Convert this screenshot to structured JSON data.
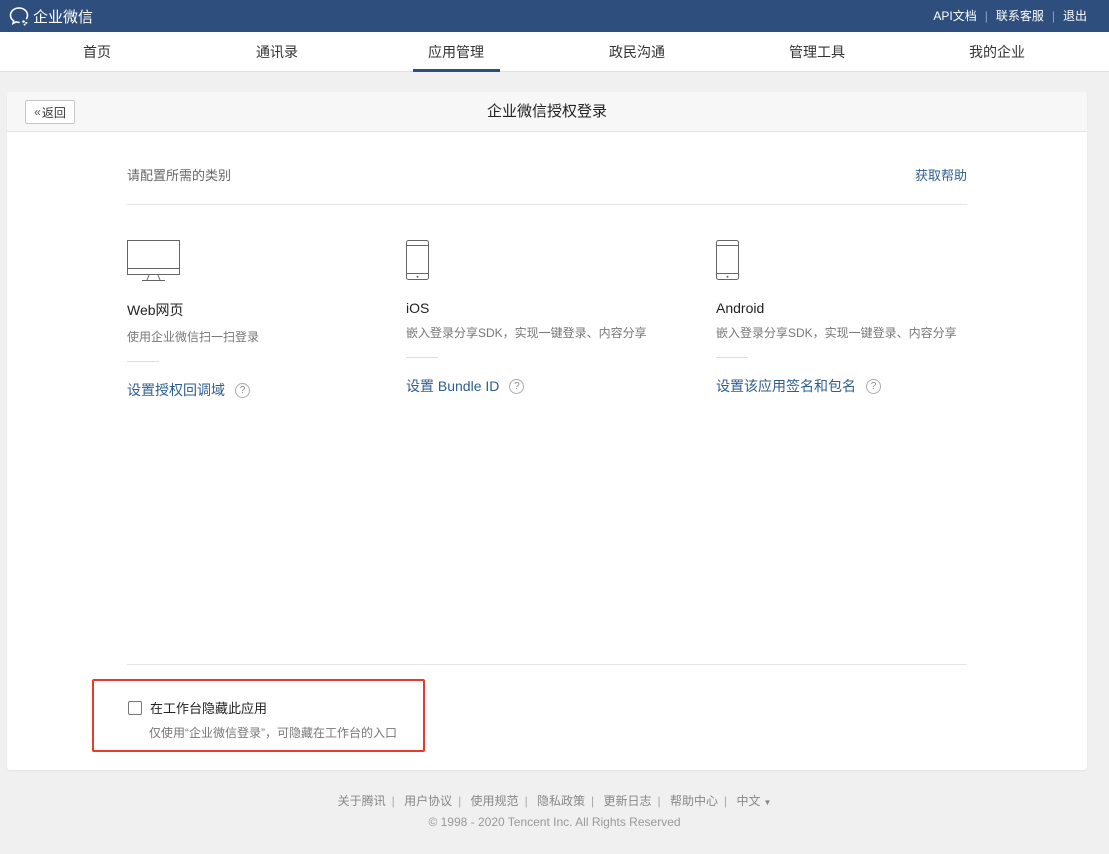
{
  "app": {
    "name": "企业微信"
  },
  "toplinks": {
    "api_docs": "API文档",
    "contact": "联系客服",
    "logout": "退出"
  },
  "nav": {
    "items": [
      {
        "label": "首页"
      },
      {
        "label": "通讯录"
      },
      {
        "label": "应用管理"
      },
      {
        "label": "政民沟通"
      },
      {
        "label": "管理工具"
      },
      {
        "label": "我的企业"
      }
    ],
    "active": "应用管理"
  },
  "panel": {
    "back_label": "返回",
    "title": "企业微信授权登录",
    "config_label": "请配置所需的类别",
    "help_link": "获取帮助"
  },
  "platforms": [
    {
      "name": "Web网页",
      "desc": "使用企业微信扫一扫登录",
      "link": "设置授权回调域",
      "icon": "monitor-icon"
    },
    {
      "name": "iOS",
      "desc": "嵌入登录分享SDK，实现一键登录、内容分享",
      "link": "设置 Bundle ID",
      "icon": "phone-icon"
    },
    {
      "name": "Android",
      "desc": "嵌入登录分享SDK，实现一键登录、内容分享",
      "link": "设置该应用签名和包名",
      "icon": "phone-icon"
    }
  ],
  "help_glyph": "?",
  "hide_option": {
    "label": "在工作台隐藏此应用",
    "desc": "仅使用“企业微信登录”，可隐藏在工作台的入口",
    "checked": false,
    "highlight_color": "#e8392d"
  },
  "footer": {
    "links": [
      "关于腾讯",
      "用户协议",
      "使用规范",
      "隐私政策",
      "更新日志",
      "帮助中心"
    ],
    "language": "中文",
    "copyright": "© 1998 - 2020 Tencent Inc. All Rights Reserved"
  },
  "colors": {
    "topbar": "#2e4e7e",
    "link": "#2e5e8e",
    "background": "#f0f0f0"
  }
}
